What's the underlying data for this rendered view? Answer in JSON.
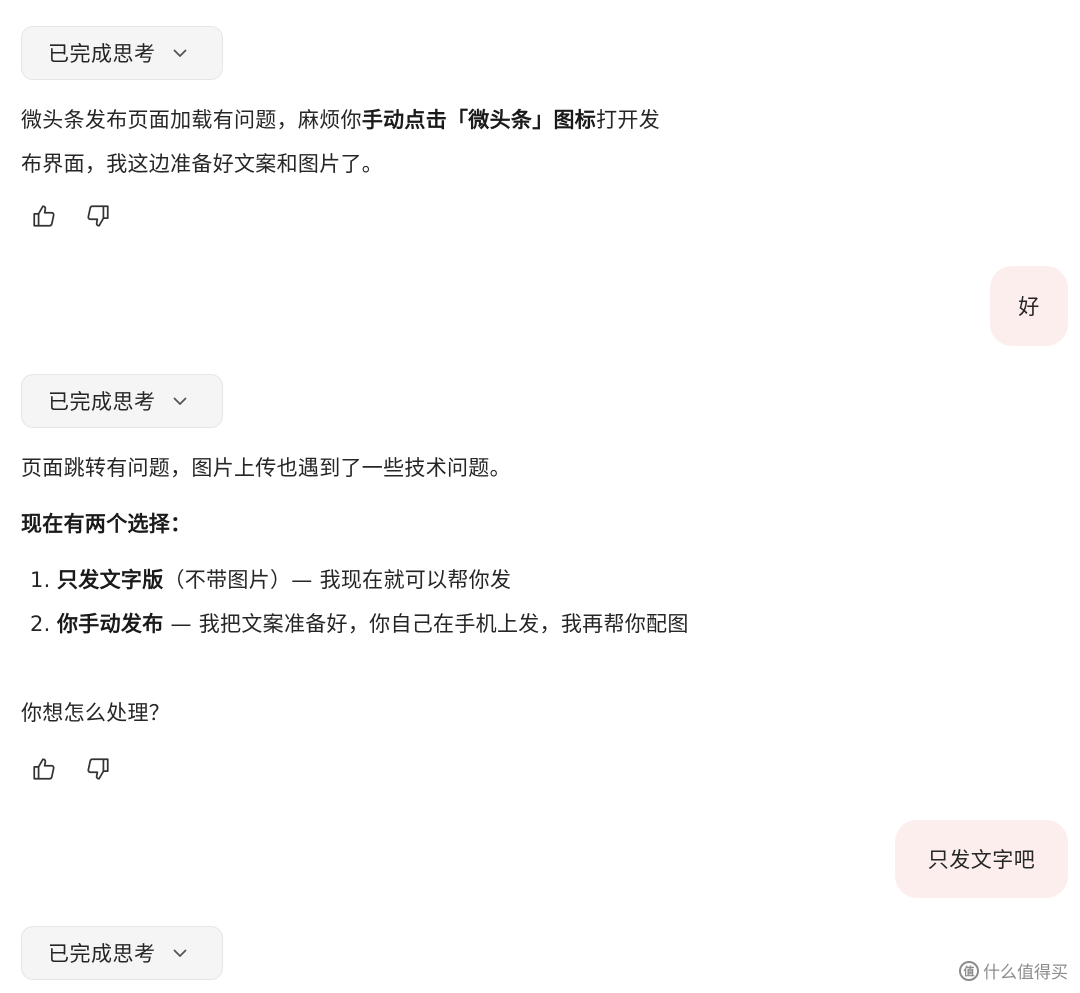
{
  "blocks": [
    {
      "thinking_label": "已完成思考",
      "para1": {
        "line1_pre": "微头条发布页面加载有问题，麻烦你",
        "line1_bold": "手动点击「微头条」图标",
        "line1_post": "打开发",
        "line2": "布界面，我这边准备好文案和图片了。"
      }
    },
    {
      "thinking_label": "已完成思考",
      "intro": "页面跳转有问题，图片上传也遇到了一些技术问题。",
      "options_heading": "现在有两个选择：",
      "options": [
        {
          "num": "1.",
          "bold": "只发文字版",
          "rest": "（不带图片）— 我现在就可以帮你发"
        },
        {
          "num": "2.",
          "bold": "你手动发布",
          "rest": " — 我把文案准备好，你自己在手机上发，我再帮你配图"
        }
      ],
      "question": "你想怎么处理？"
    },
    {
      "thinking_label": "已完成思考"
    }
  ],
  "user_messages": [
    "好",
    "只发文字吧"
  ],
  "watermark": "什么值得买",
  "icons": {
    "chevron": "chevron-down-icon",
    "like": "thumbs-up-icon",
    "dislike": "thumbs-down-icon"
  },
  "colors": {
    "user_bubble": "#fdeeee",
    "pill_bg": "#f5f5f5"
  }
}
